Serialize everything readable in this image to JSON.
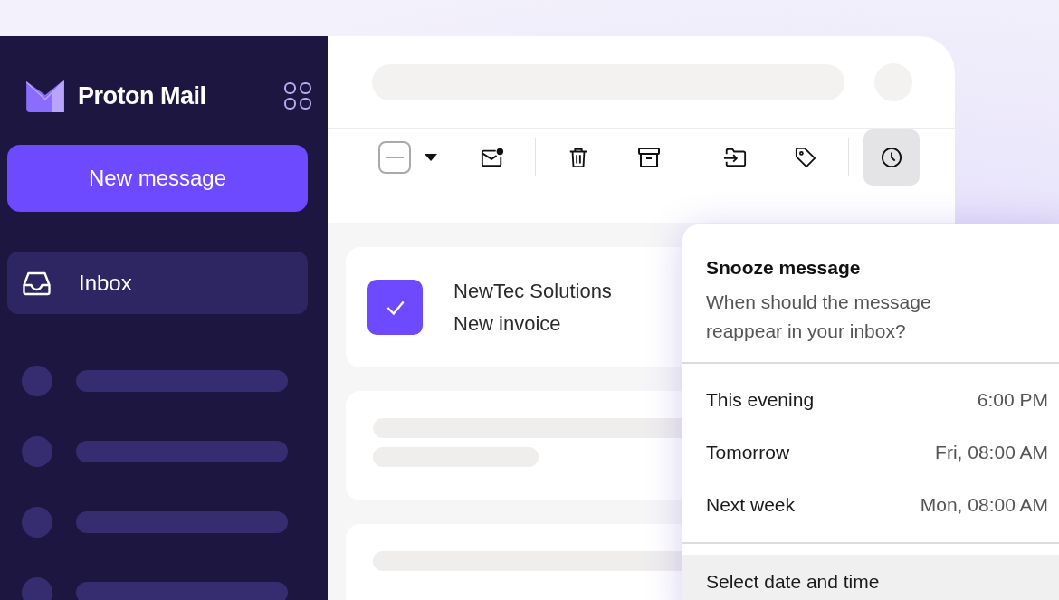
{
  "brand": {
    "name": "Proton Mail"
  },
  "sidebar": {
    "new_message": "New message",
    "items": [
      {
        "label": "Inbox",
        "selected": true
      }
    ]
  },
  "toolbar": {
    "select_all": {
      "indeterminate": true
    },
    "buttons": [
      {
        "kind": "mark-unread",
        "active": false
      },
      {
        "kind": "trash",
        "active": false
      },
      {
        "kind": "archive",
        "active": false
      },
      {
        "kind": "move",
        "active": false
      },
      {
        "kind": "label",
        "active": false
      },
      {
        "kind": "snooze",
        "active": true
      }
    ]
  },
  "messages": [
    {
      "sender": "NewTec Solutions",
      "subject": "New invoice",
      "selected": true
    }
  ],
  "snooze_menu": {
    "title": "Snooze message",
    "description": "When should the message reappear in your inbox?",
    "options": [
      {
        "label": "This evening",
        "time": "6:00 PM"
      },
      {
        "label": "Tomorrow",
        "time": "Fri, 08:00 AM"
      },
      {
        "label": "Next week",
        "time": "Mon, 08:00 AM"
      }
    ],
    "custom": {
      "label": "Select date and time",
      "highlighted": true
    }
  }
}
